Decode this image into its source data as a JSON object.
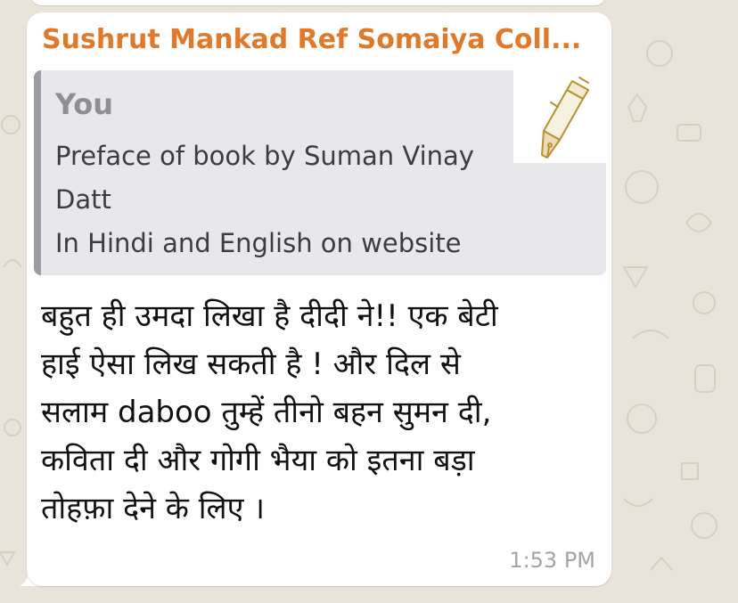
{
  "chat": {
    "sender_name": "Sushrut Mankad Ref Somaiya Coll...",
    "quote": {
      "author": "You",
      "lines": [
        "Preface of book by Suman Vinay",
        "Datt",
        "In Hindi and English on website"
      ],
      "thumbnail_icon": "fountain-pen-icon"
    },
    "message_lines": [
      "बहुत ही उमदा लिखा है दीदी ने!! एक बेटी",
      "हाई ऐसा लिख सकती है ! और दिल से",
      "सलाम daboo तुम्हें तीनो बहन सुमन दी,",
      "कविता दी और गोगी भैया को इतना बड़ा",
      "तोहफ़ा देने के लिए ।"
    ],
    "time": "1:53 PM"
  },
  "colors": {
    "sender": "#e07a2a",
    "wallpaper": "#e9e3da",
    "bubble": "#ffffff",
    "quote_background": "#e8e8ea",
    "quote_bar": "#9b9ba1"
  }
}
